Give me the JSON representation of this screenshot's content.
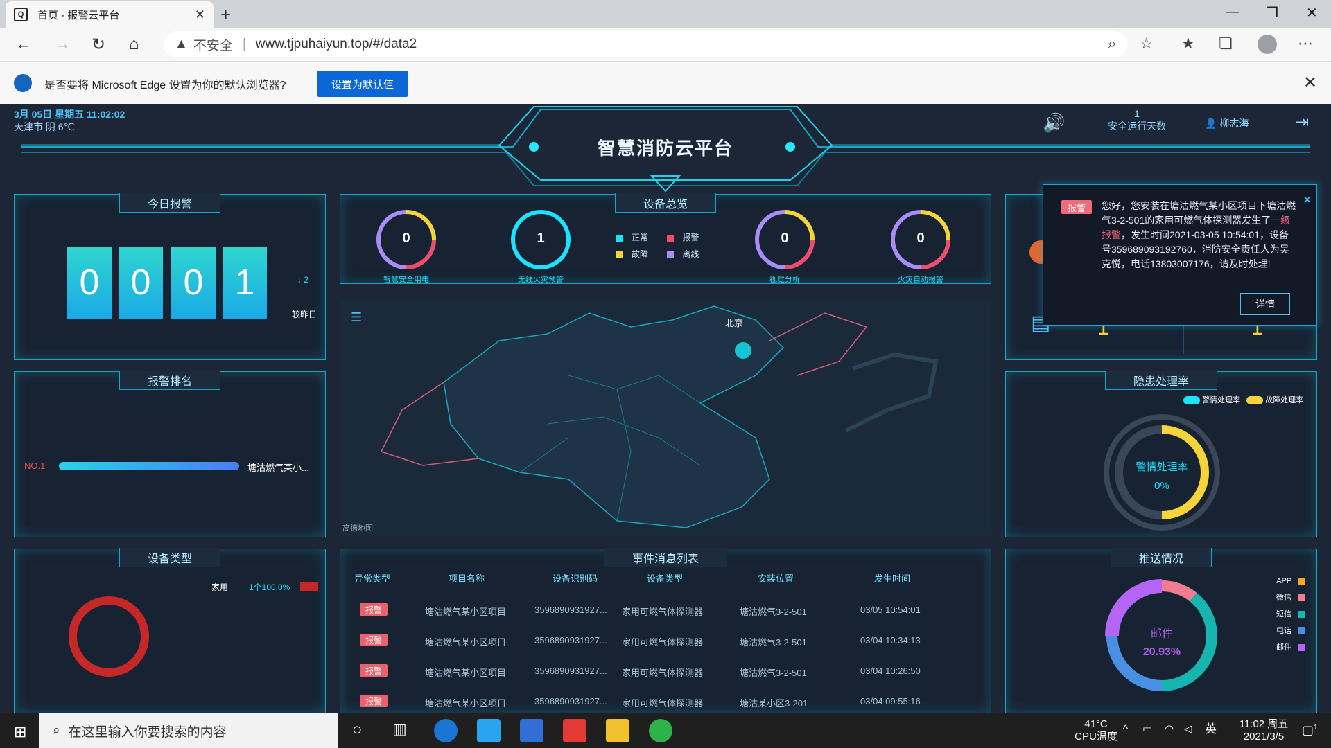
{
  "browser": {
    "tab_title": "首页 - 报警云平台",
    "tab_icon": "page-icon",
    "security_label": "不安全",
    "url": "www.tjpuhaiyun.top/#/data2"
  },
  "infobar": {
    "message": "是否要将 Microsoft Edge 设置为你的默认浏览器?",
    "button_label": "设置为默认值"
  },
  "header": {
    "datetime": "3月 05日 星期五 11:02:02",
    "weather": "天津市 阴 6℃",
    "title": "智慧消防云平台",
    "safe_days_value": "1",
    "safe_days_label": "安全运行天数",
    "user_name": "柳志海"
  },
  "today_alarm": {
    "title": "今日报警",
    "digits": [
      "0",
      "0",
      "0",
      "1"
    ],
    "compare_value": "2",
    "compare_label": "较昨日"
  },
  "alarm_rank": {
    "title": "报警排名",
    "items": [
      {
        "rank": "NO.1",
        "name": "塘沽燃气某小...",
        "fraction": 1.0
      }
    ]
  },
  "device_type": {
    "title": "设备类型",
    "legend": [
      {
        "name": "家用",
        "value": "1个100.0%",
        "color": "#c62828"
      }
    ]
  },
  "device_overview": {
    "title": "设备总览",
    "legend": [
      {
        "name": "正常",
        "color": "#19e3ff"
      },
      {
        "name": "报警",
        "color": "#ef4b6b"
      },
      {
        "name": "故障",
        "color": "#f5d43a"
      },
      {
        "name": "离线",
        "color": "#a98cf5"
      }
    ],
    "gauges": [
      {
        "value": "0",
        "label": "智慧安全用电"
      },
      {
        "value": "1",
        "label": "无线火灾预警"
      },
      {
        "value": "0",
        "label": "视觉分析"
      },
      {
        "value": "0",
        "label": "火灾自动报警"
      }
    ]
  },
  "map": {
    "city_label": "北京",
    "watermark": "高德地图"
  },
  "right_top": {
    "value_a": "1",
    "value_b": "1"
  },
  "hazard": {
    "title": "隐患处理率",
    "legend": [
      {
        "name": "警情处理率",
        "color": "#19e3ff"
      },
      {
        "name": "故障处理率",
        "color": "#f5d43a"
      }
    ],
    "center_label": "警情处理率",
    "center_value": "0%"
  },
  "events": {
    "title": "事件消息列表",
    "headers": [
      "异常类型",
      "项目名称",
      "设备识别码",
      "设备类型",
      "安装位置",
      "发生时间"
    ],
    "rows": [
      [
        "报警",
        "塘沽燃气某小区项目",
        "3596890931927...",
        "家用可燃气体探测器",
        "塘沽燃气3-2-501",
        "03/05 10:54:01"
      ],
      [
        "报警",
        "塘沽燃气某小区项目",
        "3596890931927...",
        "家用可燃气体探测器",
        "塘沽燃气3-2-501",
        "03/04 10:34:13"
      ],
      [
        "报警",
        "塘沽燃气某小区项目",
        "3596890931927...",
        "家用可燃气体探测器",
        "塘沽燃气3-2-501",
        "03/04 10:26:50"
      ],
      [
        "报警",
        "塘沽燃气某小区项目",
        "3596890931927...",
        "家用可燃气体探测器",
        "塘沽某小区3-201",
        "03/04 09:55:16"
      ]
    ]
  },
  "push": {
    "title": "推送情况",
    "legend": [
      {
        "name": "APP",
        "color": "#f5a623"
      },
      {
        "name": "微信",
        "color": "#f27b8f"
      },
      {
        "name": "短信",
        "color": "#16b5b0"
      },
      {
        "name": "电话",
        "color": "#4a90e2"
      },
      {
        "name": "邮件",
        "color": "#b565f5"
      }
    ],
    "center_label": "邮件",
    "center_value": "20.93%"
  },
  "popup": {
    "tag": "报警",
    "msg_a": "您好，您安装在塘沽燃气某小区项目下塘沽燃气3-2-501的家用可燃气体探测器发生了",
    "msg_level": "一级报警",
    "msg_b": "，发生时间2021-03-05 10:54:01，设备号359689093192760，消防安全责任人为吴克悦，电话13803007176，请及时处理!",
    "button": "详情"
  },
  "taskbar": {
    "search_placeholder": "在这里输入你要搜索的内容",
    "temp": "41°C",
    "temp_label": "CPU温度",
    "ime": "英",
    "time": "11:02 周五",
    "date": "2021/3/5",
    "notify_count": "1"
  }
}
